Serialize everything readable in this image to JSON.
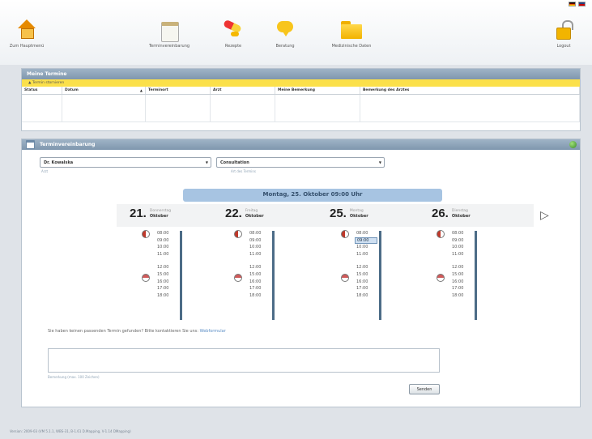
{
  "toolbar": {
    "home": "Zum Hauptmenü",
    "appointment": "Terminvereinbarung",
    "recipes": "Rezepte",
    "consultation": "Beratung",
    "medical_data": "Medizinische Daten",
    "logout": "Logout"
  },
  "my_appointments": {
    "title": "Meine Termine",
    "strip": "Termin stornieren",
    "columns": [
      "Status",
      "Datum",
      "Terminort",
      "Arzt",
      "Meine Bemerkung",
      "Bemerkung des Arztes"
    ]
  },
  "booking": {
    "title": "Terminvereinbarung",
    "doctor_select": "Dr. Kowalska",
    "doctor_hint": "Arzt",
    "type_select": "Consultation",
    "type_hint": "Art des Termins",
    "selected_banner": "Montag, 25. Oktober 09:00 Uhr",
    "days": [
      {
        "num": "21.",
        "weekday": "Donnerstag",
        "month": "Oktober",
        "slots": [
          "08:00",
          "09:00",
          "10:00",
          "11:00",
          "12:00",
          "15:00",
          "16:00",
          "17:00",
          "18:00"
        ]
      },
      {
        "num": "22.",
        "weekday": "Freitag",
        "month": "Oktober",
        "slots": [
          "08:00",
          "09:00",
          "10:00",
          "11:00",
          "12:00",
          "15:00",
          "16:00",
          "17:00",
          "18:00"
        ]
      },
      {
        "num": "25.",
        "weekday": "Montag",
        "month": "Oktober",
        "slots": [
          "08:00",
          "09:00",
          "10:00",
          "11:00",
          "12:00",
          "15:00",
          "16:00",
          "17:00",
          "18:00"
        ]
      },
      {
        "num": "26.",
        "weekday": "Dienstag",
        "month": "Oktober",
        "slots": [
          "08:00",
          "09:00",
          "10:00",
          "11:00",
          "12:00",
          "15:00",
          "16:00",
          "17:00",
          "18:00"
        ]
      }
    ],
    "selected_slot": {
      "day": 2,
      "slot": 1
    },
    "info_text": "Sie haben keinen passenden Termin gefunden? Bitte kontaktieren Sie uns:",
    "info_link": "Webformular",
    "remark_hint": "Bemerkung (max. 100 Zeichen)",
    "submit": "Senden"
  },
  "footer": "Version: 2009-03 (VM 5.1.1, WBS-31, B-1.61 D.Mapping, V-1.14 DMapping)"
}
